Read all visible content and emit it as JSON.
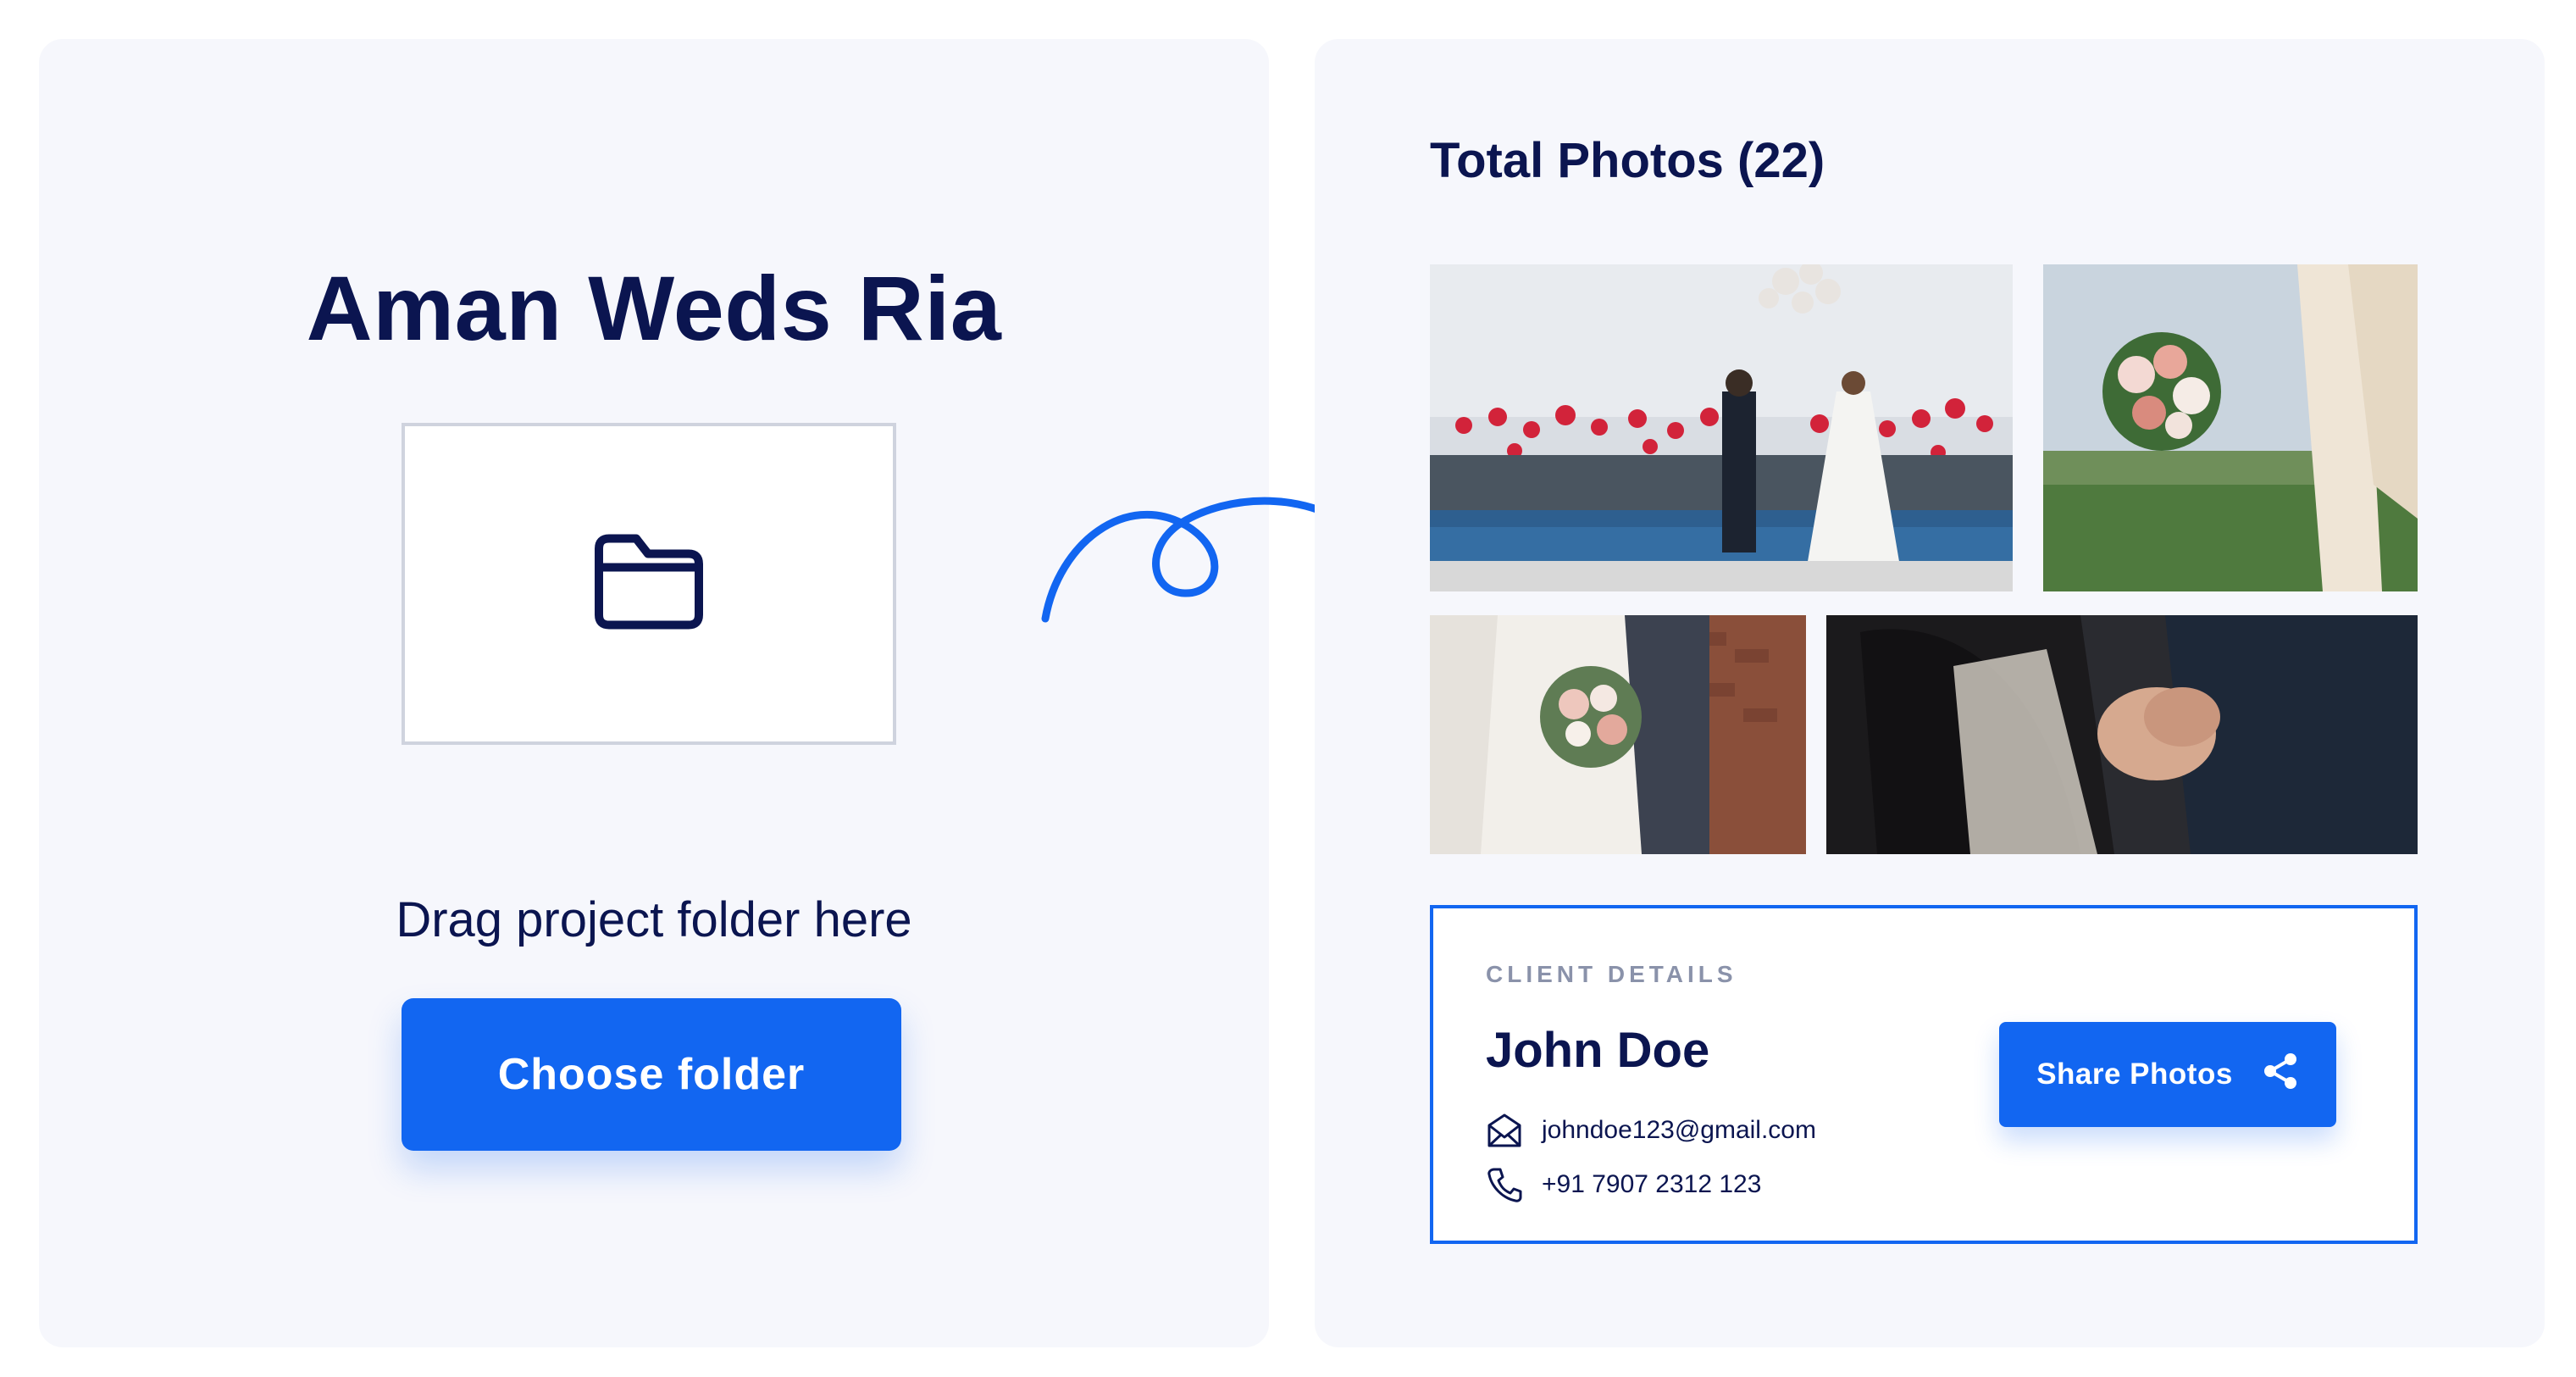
{
  "left_panel": {
    "project_title": "Aman Weds Ria",
    "drop_zone_icon": "folder-icon",
    "drag_text": "Drag project folder here",
    "choose_button_label": "Choose folder"
  },
  "connector": {
    "icon": "curly-arrow-icon",
    "color": "#1266f1"
  },
  "right_panel": {
    "photos_title": "Total Photos (22)",
    "photos": [
      {
        "name": "wedding-balloons-photo"
      },
      {
        "name": "bouquet-arch-photo"
      },
      {
        "name": "couple-bouquet-photo"
      },
      {
        "name": "couple-dance-photo"
      }
    ],
    "client": {
      "section_label": "CLIENT DETAILS",
      "name": "John Doe",
      "email": "johndoe123@gmail.com",
      "phone": "+91 7907 2312 123",
      "share_button_label": "Share Photos"
    }
  },
  "colors": {
    "accent": "#1266f1",
    "text_dark": "#0b1550",
    "panel_bg": "#f6f7fc",
    "label_gray": "#8a92aa"
  }
}
